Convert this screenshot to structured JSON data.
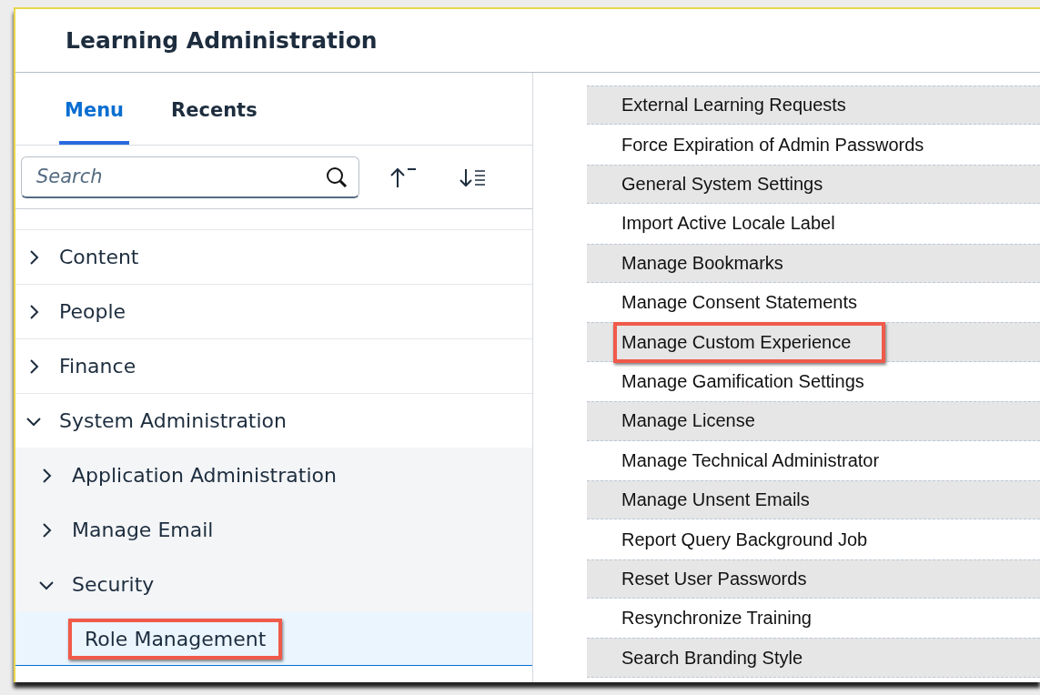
{
  "window": {
    "title": "Learning Administration"
  },
  "tabs": [
    {
      "label": "Menu",
      "selected": true
    },
    {
      "label": "Recents",
      "selected": false
    }
  ],
  "search": {
    "placeholder": "Search"
  },
  "tree": [
    {
      "label": "Content",
      "expanded": false,
      "selected": false,
      "highlighted": false
    },
    {
      "label": "People",
      "expanded": false,
      "selected": false,
      "highlighted": false
    },
    {
      "label": "Finance",
      "expanded": false,
      "selected": false,
      "highlighted": false
    },
    {
      "label": "System Administration",
      "expanded": true,
      "selected": false,
      "highlighted": false,
      "children": [
        {
          "label": "Application Administration",
          "expanded": false,
          "selected": false,
          "highlighted": false
        },
        {
          "label": "Manage Email",
          "expanded": false,
          "selected": false,
          "highlighted": false
        },
        {
          "label": "Security",
          "expanded": true,
          "selected": false,
          "highlighted": false,
          "children": [
            {
              "label": "Role Management",
              "selected": true,
              "highlighted": true
            }
          ]
        }
      ]
    }
  ],
  "links": [
    {
      "label": "External Learning Requests",
      "highlighted": false
    },
    {
      "label": "Force Expiration of Admin Passwords",
      "highlighted": false
    },
    {
      "label": "General System Settings",
      "highlighted": false
    },
    {
      "label": "Import Active Locale Label",
      "highlighted": false
    },
    {
      "label": "Manage Bookmarks",
      "highlighted": false
    },
    {
      "label": "Manage Consent Statements",
      "highlighted": false
    },
    {
      "label": "Manage Custom Experience",
      "highlighted": true
    },
    {
      "label": "Manage Gamification Settings",
      "highlighted": false
    },
    {
      "label": "Manage License",
      "highlighted": false
    },
    {
      "label": "Manage Technical Administrator",
      "highlighted": false
    },
    {
      "label": "Manage Unsent Emails",
      "highlighted": false
    },
    {
      "label": "Report Query Background Job",
      "highlighted": false
    },
    {
      "label": "Reset User Passwords",
      "highlighted": false
    },
    {
      "label": "Resynchronize Training",
      "highlighted": false
    },
    {
      "label": "Search Branding Style",
      "highlighted": false
    }
  ]
}
